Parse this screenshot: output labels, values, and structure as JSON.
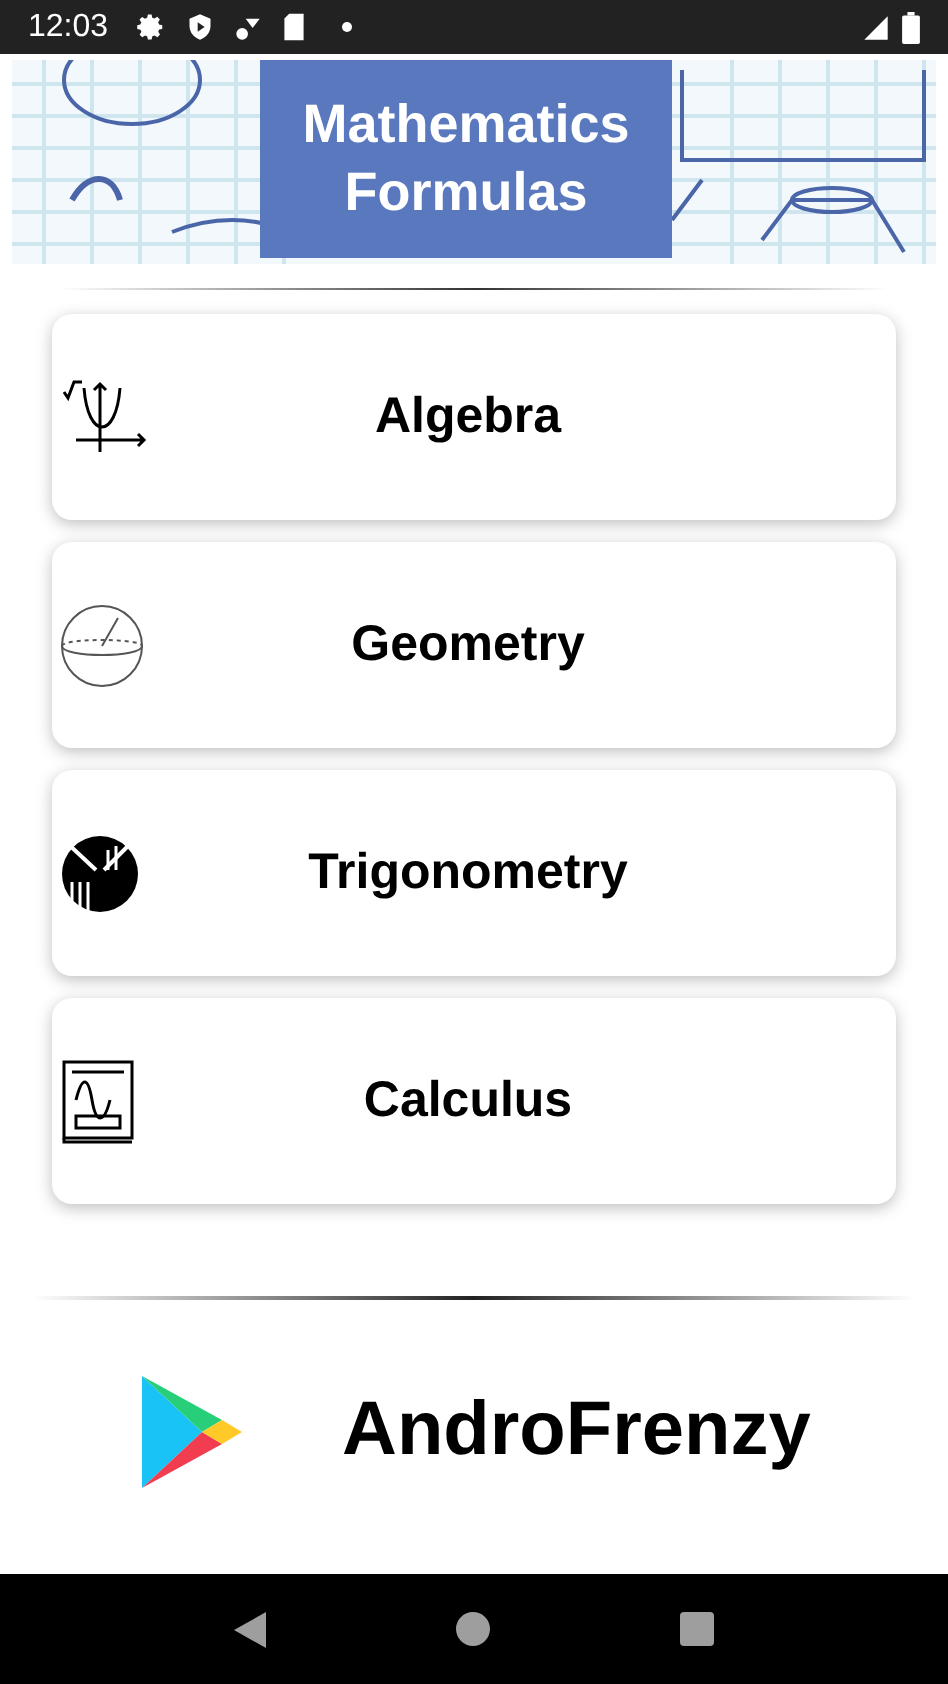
{
  "status_bar": {
    "time": "12:03"
  },
  "banner": {
    "title": "Mathematics Formulas"
  },
  "topics": [
    {
      "label": "Algebra"
    },
    {
      "label": "Geometry"
    },
    {
      "label": "Trigonometry"
    },
    {
      "label": "Calculus"
    }
  ],
  "footer": {
    "brand": "AndroFrenzy"
  }
}
